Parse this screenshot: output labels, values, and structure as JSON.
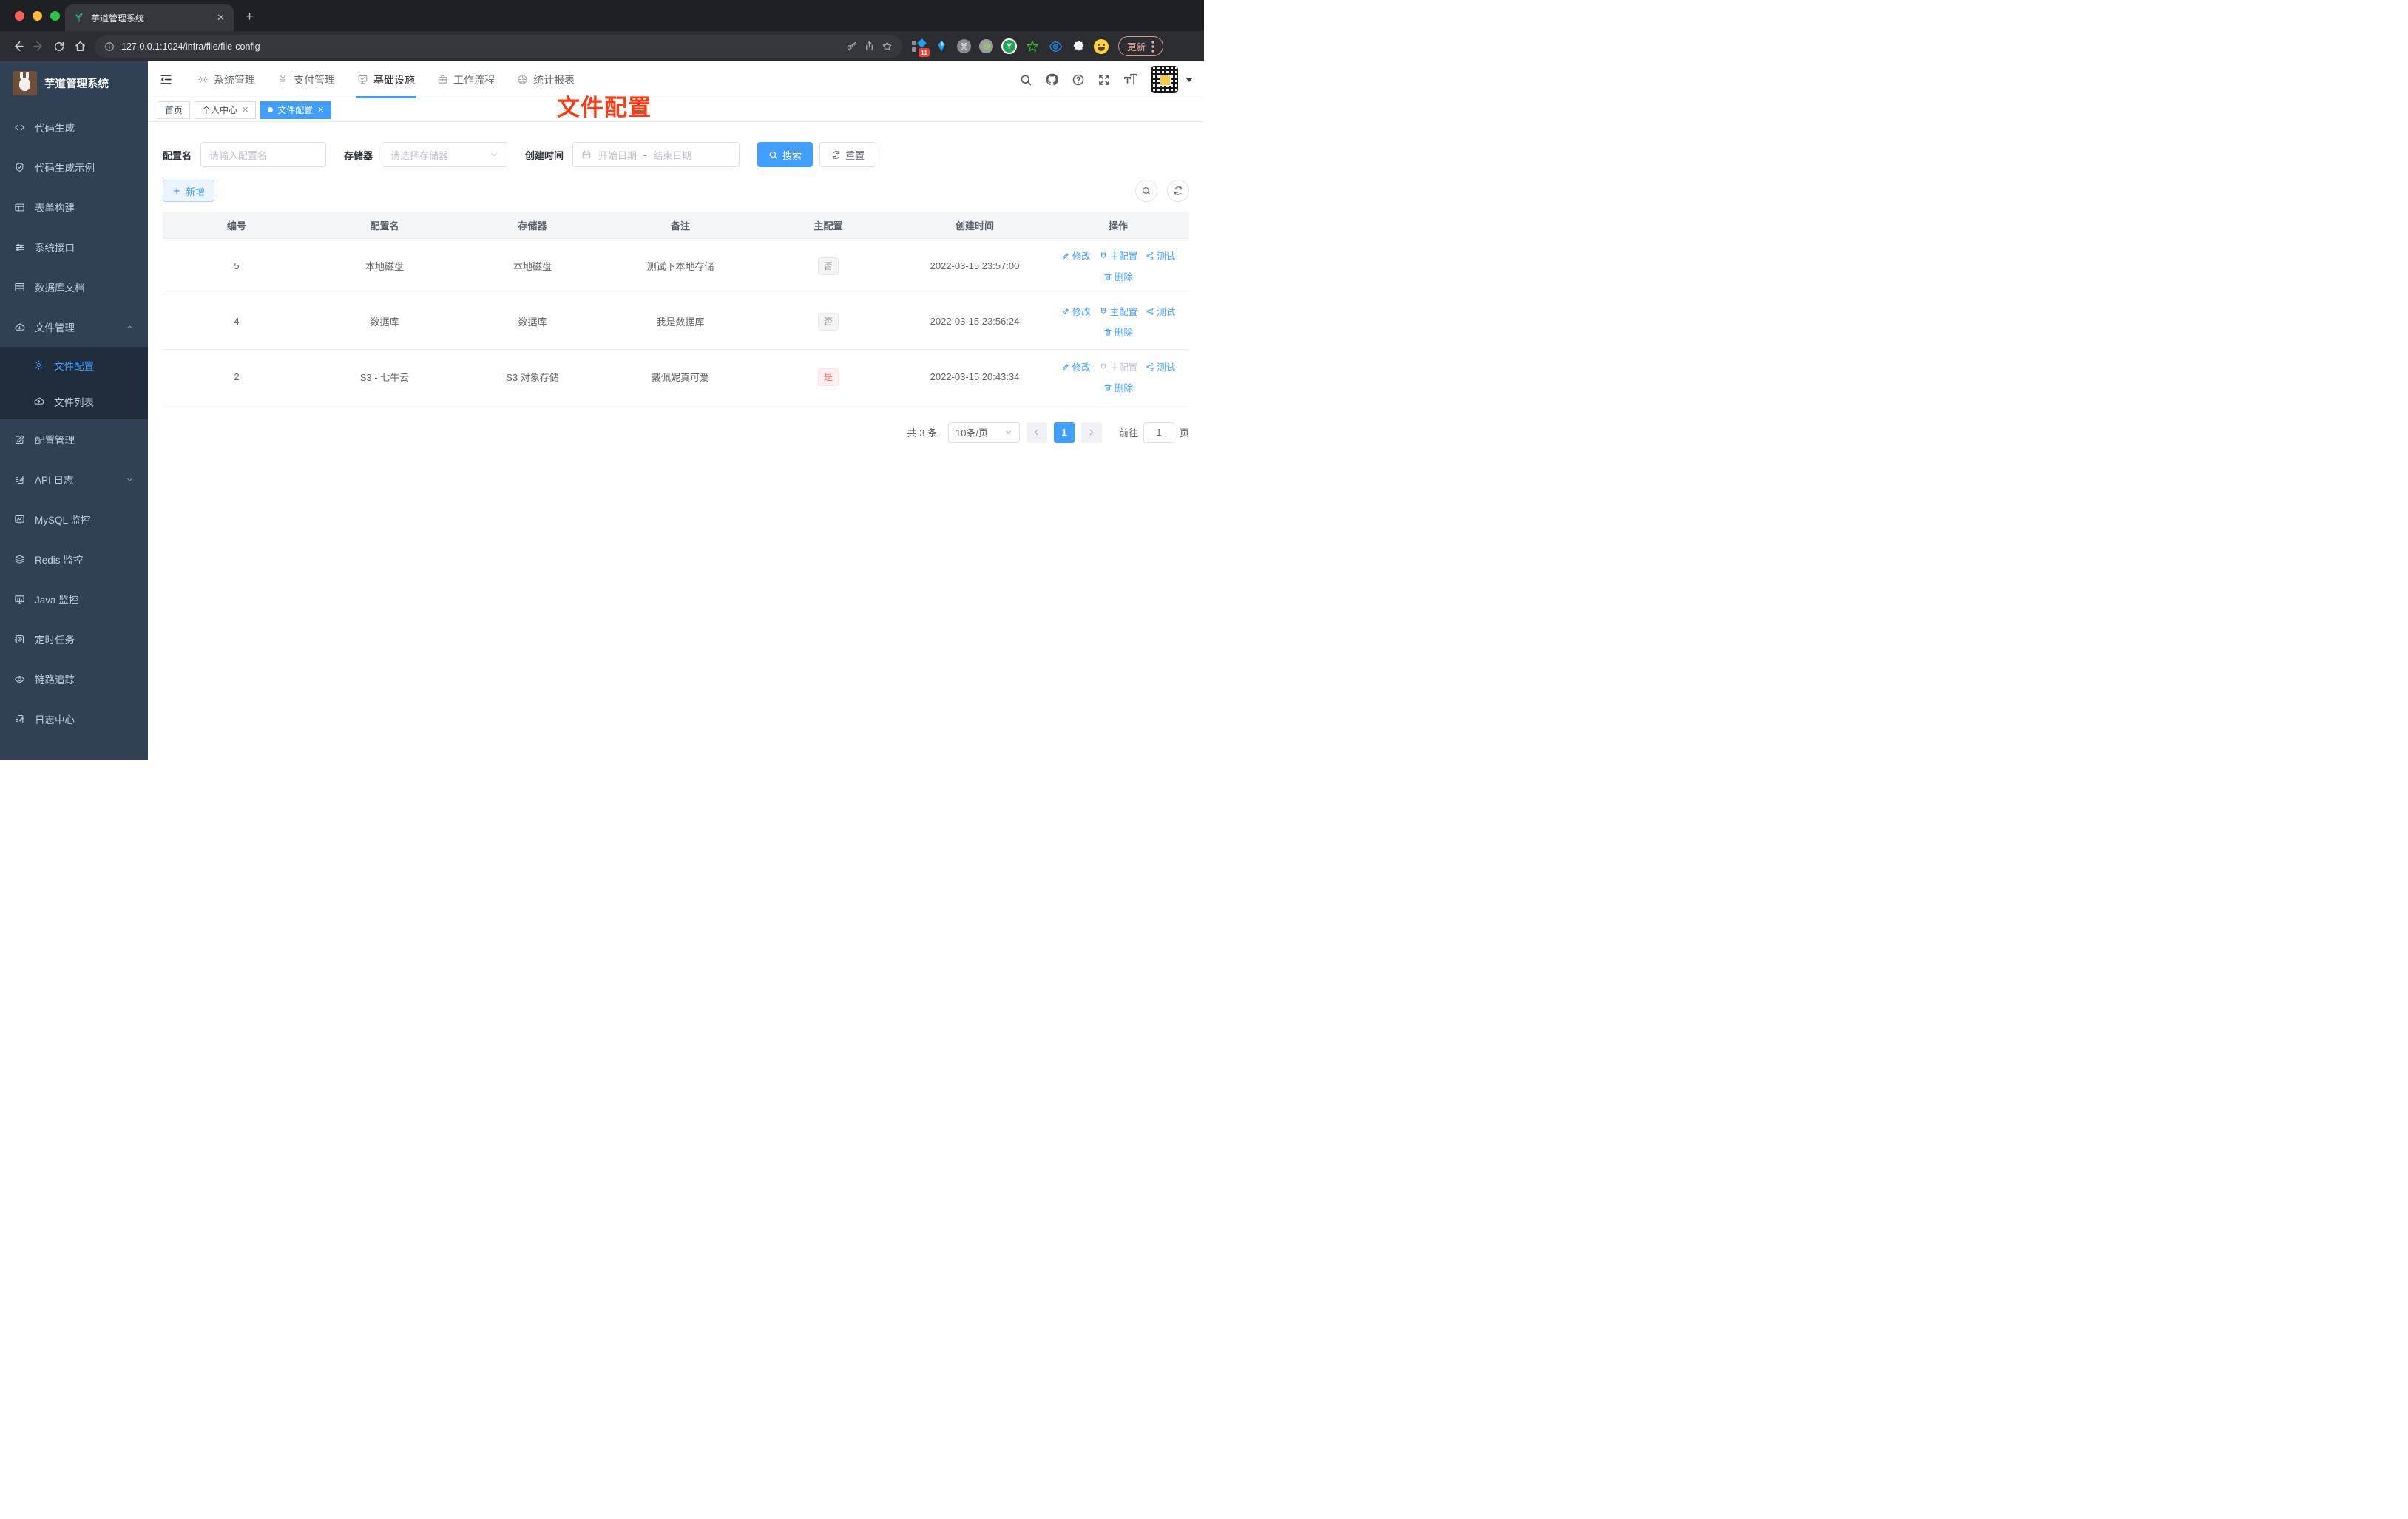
{
  "colors": {
    "accent": "#409eff",
    "danger": "#f56c6c",
    "annotation_red": "#f83b16",
    "sidebar_bg": "#304156",
    "submenu_bg": "#1f2d3d"
  },
  "browser": {
    "tab_title": "芋道管理系统",
    "url": "127.0.0.1:1024/infra/file/file-config",
    "extension_badge": "11",
    "extension_y_letter": "Y",
    "update_label": "更新"
  },
  "app": {
    "title": "芋道管理系统"
  },
  "sidebar": {
    "items": [
      {
        "label": "代码生成",
        "icon": "code"
      },
      {
        "label": "代码生成示例",
        "icon": "shield"
      },
      {
        "label": "表单构建",
        "icon": "form"
      },
      {
        "label": "系统接口",
        "icon": "sliders"
      },
      {
        "label": "数据库文档",
        "icon": "tableic"
      },
      {
        "label": "文件管理",
        "icon": "cloud-down",
        "chevron": "up"
      },
      {
        "label": "文件配置",
        "icon": "gear",
        "sub": true,
        "active": true
      },
      {
        "label": "文件列表",
        "icon": "cloud-up",
        "sub": true
      },
      {
        "label": "配置管理",
        "icon": "edit-square"
      },
      {
        "label": "API 日志",
        "icon": "edit-doc",
        "chevron": "down"
      },
      {
        "label": "MySQL 监控",
        "icon": "chart"
      },
      {
        "label": "Redis 监控",
        "icon": "layers"
      },
      {
        "label": "Java 监控",
        "icon": "monitor"
      },
      {
        "label": "定时任务",
        "icon": "schedule"
      },
      {
        "label": "链路追踪",
        "icon": "eye"
      },
      {
        "label": "日志中心",
        "icon": "edit-doc"
      }
    ]
  },
  "top_nav": {
    "items": [
      {
        "label": "系统管理",
        "icon": "gear"
      },
      {
        "label": "支付管理",
        "icon": "yen"
      },
      {
        "label": "基础设施",
        "icon": "infra",
        "active": true
      },
      {
        "label": "工作流程",
        "icon": "briefcase"
      },
      {
        "label": "统计报表",
        "icon": "dashboard"
      }
    ]
  },
  "tags": [
    {
      "label": "首页"
    },
    {
      "label": "个人中心",
      "closable": true
    },
    {
      "label": "文件配置",
      "closable": true,
      "active": true,
      "dot": true
    }
  ],
  "annotation": "文件配置",
  "filter": {
    "name_label": "配置名",
    "name_placeholder": "请输入配置名",
    "storage_label": "存储器",
    "storage_placeholder": "请选择存储器",
    "time_label": "创建时间",
    "start_placeholder": "开始日期",
    "range_dash": "-",
    "end_placeholder": "结束日期",
    "search_label": "搜索",
    "reset_label": "重置"
  },
  "toolbar": {
    "add_label": "新增"
  },
  "table": {
    "headers": [
      "编号",
      "配置名",
      "存储器",
      "备注",
      "主配置",
      "创建时间",
      "操作"
    ],
    "action_labels": {
      "edit": "修改",
      "master": "主配置",
      "test": "测试",
      "delete": "删除"
    },
    "rows": [
      {
        "id": "5",
        "name": "本地磁盘",
        "storage": "本地磁盘",
        "remark": "测试下本地存储",
        "primary": "否",
        "primary_type": "info",
        "created": "2022-03-15 23:57:00",
        "master_disabled": false
      },
      {
        "id": "4",
        "name": "数据库",
        "storage": "数据库",
        "remark": "我是数据库",
        "primary": "否",
        "primary_type": "info",
        "created": "2022-03-15 23:56:24",
        "master_disabled": false
      },
      {
        "id": "2",
        "name": "S3 - 七牛云",
        "storage": "S3 对象存储",
        "remark": "戴佩妮真可爱",
        "primary": "是",
        "primary_type": "danger",
        "created": "2022-03-15 20:43:34",
        "master_disabled": true
      }
    ]
  },
  "pagination": {
    "total": "共 3 条",
    "page_size": "10条/页",
    "page": "1",
    "goto_label": "前往",
    "goto_value": "1",
    "unit_label": "页"
  }
}
